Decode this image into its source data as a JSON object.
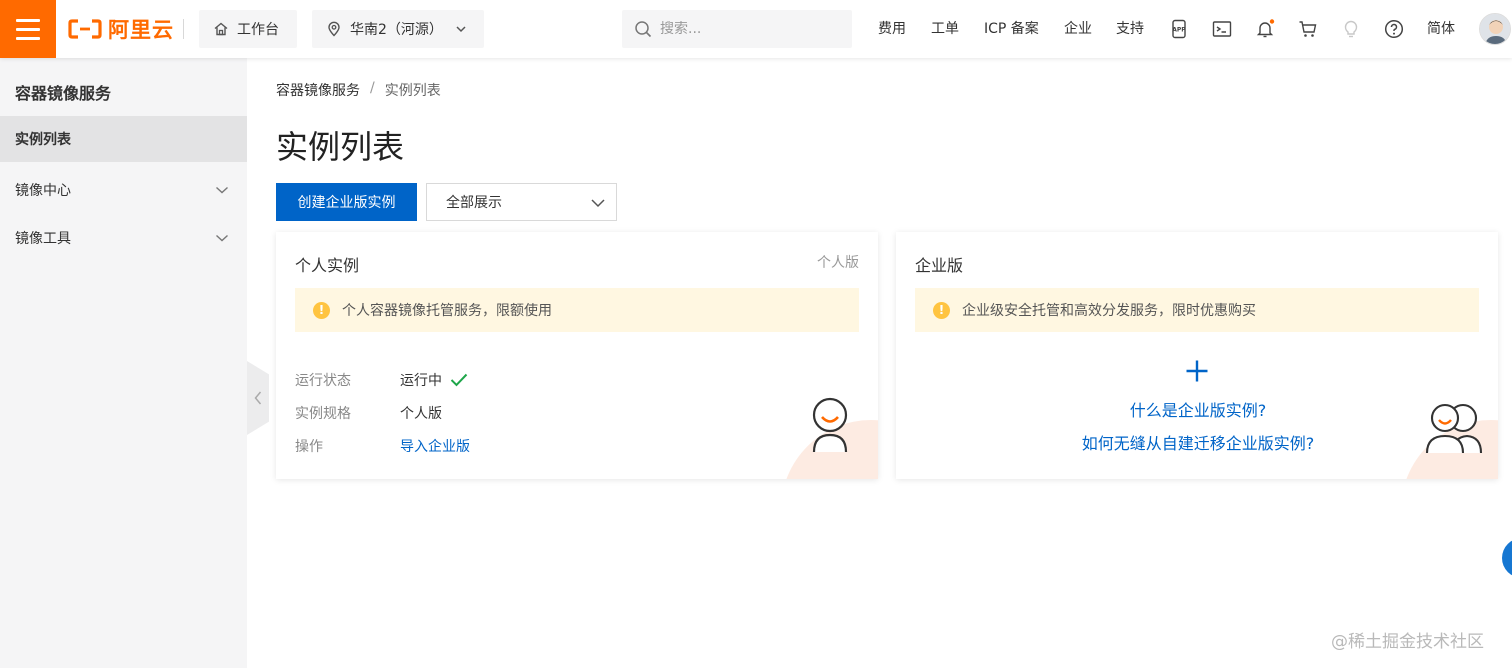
{
  "topbar": {
    "logo_text": "阿里云",
    "workbench": "工作台",
    "region": "华南2（河源）",
    "search_placeholder": "搜索...",
    "nav": [
      "费用",
      "工单",
      "ICP 备案",
      "企业",
      "支持"
    ],
    "language": "简体",
    "icons": [
      "app-icon",
      "terminal-icon",
      "bell-icon",
      "cart-icon",
      "bulb-icon",
      "help-icon"
    ],
    "accent": "#ff6a00"
  },
  "sidebar": {
    "title": "容器镜像服务",
    "items": [
      {
        "label": "实例列表",
        "active": true
      },
      {
        "label": "镜像中心",
        "expandable": true
      },
      {
        "label": "镜像工具",
        "expandable": true
      }
    ]
  },
  "main": {
    "breadcrumb": [
      "容器镜像服务",
      "实例列表"
    ],
    "breadcrumb_sep": "/",
    "title": "实例列表",
    "create_button": "创建企业版实例",
    "filter_value": "全部展示",
    "primary_color": "#0064c8"
  },
  "personal_card": {
    "title": "个人实例",
    "tag": "个人版",
    "notice": "个人容器镜像托管服务，限额使用",
    "rows": [
      {
        "label": "运行状态",
        "value": "运行中"
      },
      {
        "label": "实例规格",
        "value": "个人版"
      },
      {
        "label": "操作",
        "value": "导入企业版"
      }
    ]
  },
  "enterprise_card": {
    "title": "企业版",
    "notice": "企业级安全托管和高效分发服务，限时优惠购买",
    "link1": "什么是企业版实例?",
    "link2": "如何无缝从自建迁移企业版实例?"
  },
  "watermark": "@稀土掘金技术社区"
}
